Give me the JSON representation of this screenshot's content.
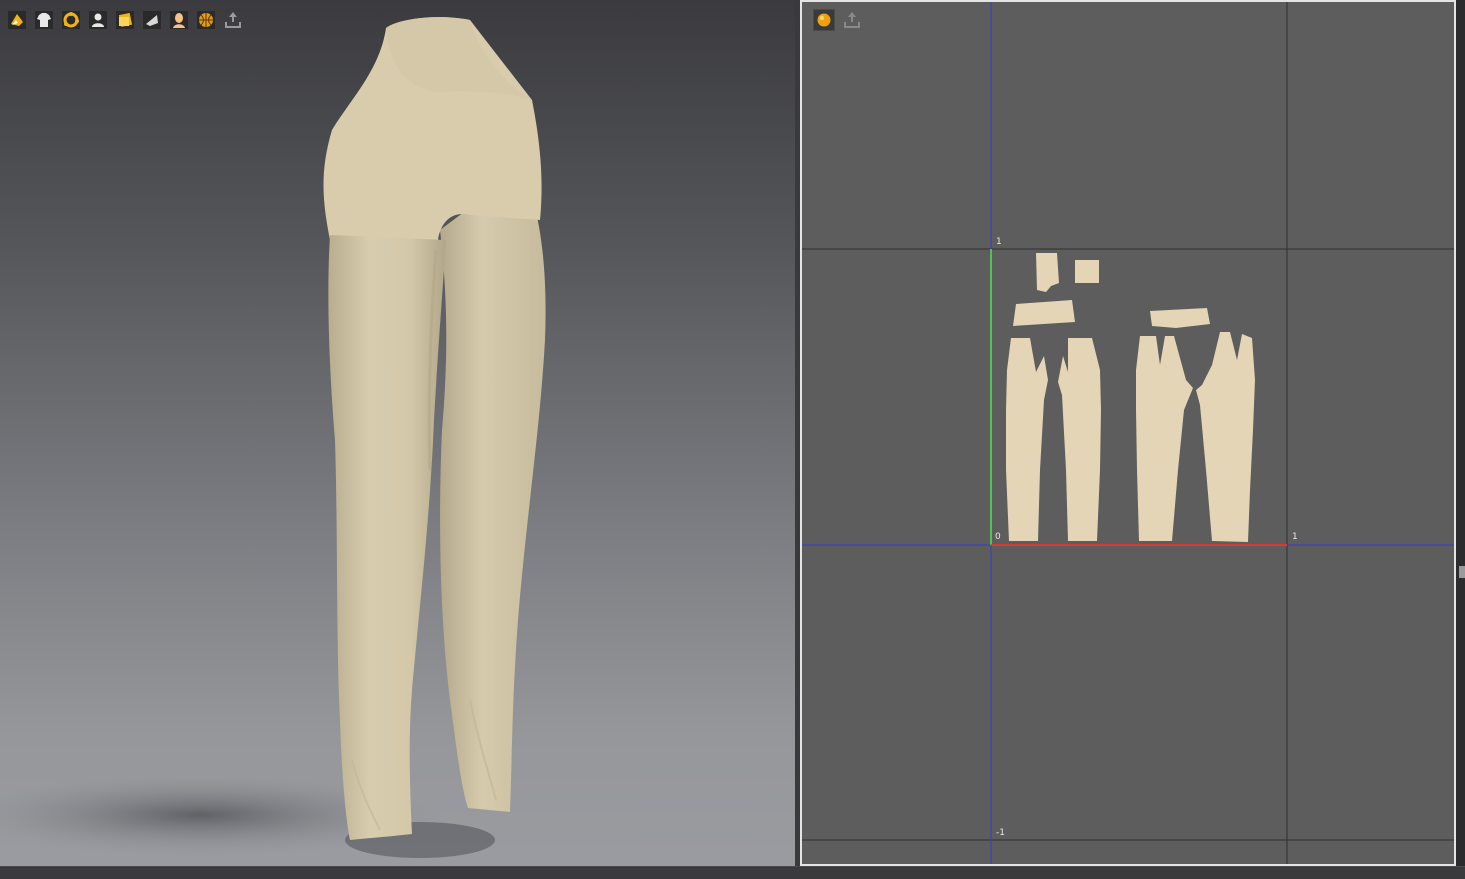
{
  "viewport3d": {
    "toolbar": [
      {
        "icon": "3d-garment-display-icon"
      },
      {
        "icon": "garment-shirt-icon"
      },
      {
        "icon": "sewing-points-icon"
      },
      {
        "icon": "avatar-display-icon"
      },
      {
        "icon": "texture-layer-icon"
      },
      {
        "icon": "fabric-flag-icon"
      },
      {
        "icon": "avatar-skin-icon"
      },
      {
        "icon": "mesh-sphere-icon"
      },
      {
        "icon": "export-icon"
      }
    ],
    "garment_color": "#d9cdae"
  },
  "viewport2d": {
    "toolbar": [
      {
        "icon": "display-sphere-icon"
      },
      {
        "icon": "export-icon"
      }
    ],
    "axis_labels": {
      "top_one": "1",
      "origin": "0",
      "right_one": "1",
      "bottom_minus_one": "-1"
    },
    "colors": {
      "x_axis": "#d63b3b",
      "y_axis": "#4fc24f",
      "blue_axis": "#3b3bc8",
      "grid": "#2e2e2e",
      "piece": "#e3d5b6"
    }
  }
}
